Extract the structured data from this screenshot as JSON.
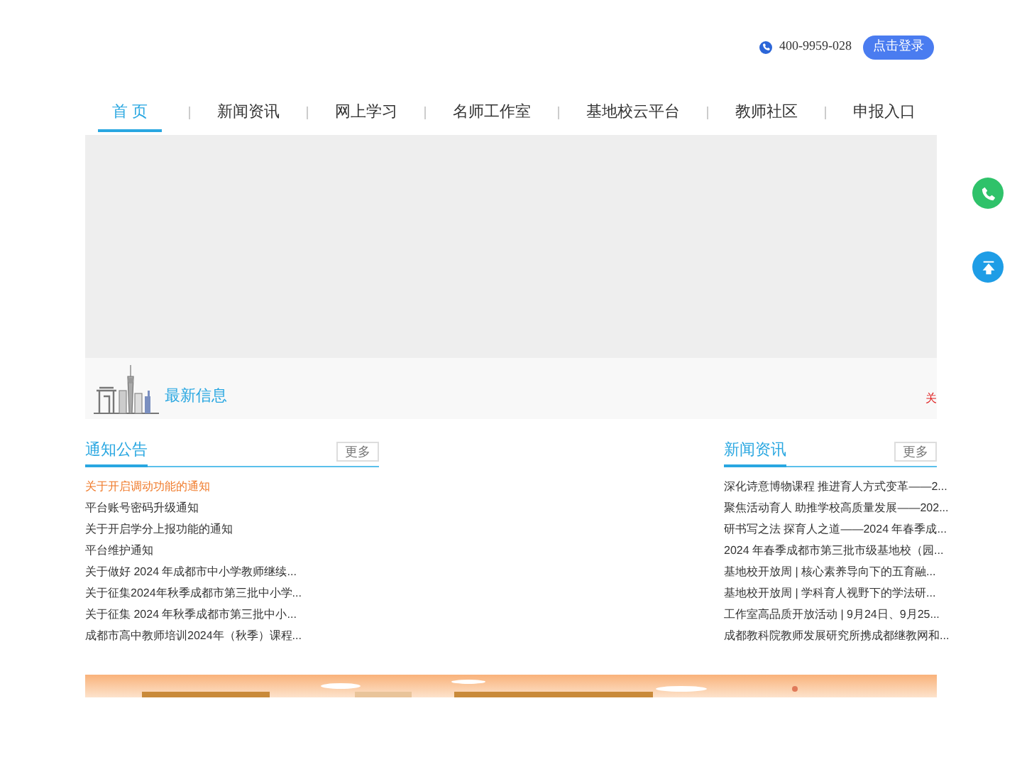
{
  "header": {
    "phone": "400-9959-028",
    "login_button": "点击登录"
  },
  "nav": [
    {
      "label": "首 页",
      "selected": true
    },
    {
      "label": "新闻资讯",
      "selected": false
    },
    {
      "label": "网上学习",
      "selected": false
    },
    {
      "label": "名师工作室",
      "selected": false
    },
    {
      "label": "基地校云平台",
      "selected": false
    },
    {
      "label": "教师社区",
      "selected": false
    },
    {
      "label": "申报入口",
      "selected": false
    }
  ],
  "latest": {
    "title": "最新信息",
    "ticker": "关"
  },
  "notices": {
    "title": "通知公告",
    "more": "更多",
    "items": [
      {
        "text": "关于开启调动功能的通知",
        "highlighted": true
      },
      {
        "text": "平台账号密码升级通知",
        "highlighted": false
      },
      {
        "text": "关于开启学分上报功能的通知",
        "highlighted": false
      },
      {
        "text": "平台维护通知",
        "highlighted": false
      },
      {
        "text": "关于做好 2024 年成都市中小学教师继续...",
        "highlighted": false
      },
      {
        "text": "关于征集2024年秋季成都市第三批中小学...",
        "highlighted": false
      },
      {
        "text": "关于征集 2024 年秋季成都市第三批中小...",
        "highlighted": false
      },
      {
        "text": "成都市高中教师培训2024年（秋季）课程...",
        "highlighted": false
      }
    ]
  },
  "news": {
    "title": "新闻资讯",
    "more": "更多",
    "items": [
      "深化诗意博物课程 推进育人方式变革——2...",
      "聚焦活动育人 助推学校高质量发展——202...",
      "研书写之法 探育人之道——2024 年春季成...",
      "2024 年春季成都市第三批市级基地校（园...",
      "基地校开放周 | 核心素养导向下的五育融...",
      "基地校开放周 | 学科育人视野下的学法研...",
      "工作室高品质开放活动 | 9月24日、9月25...",
      "成都教科院教师发展研究所携成都继教网和..."
    ]
  }
}
